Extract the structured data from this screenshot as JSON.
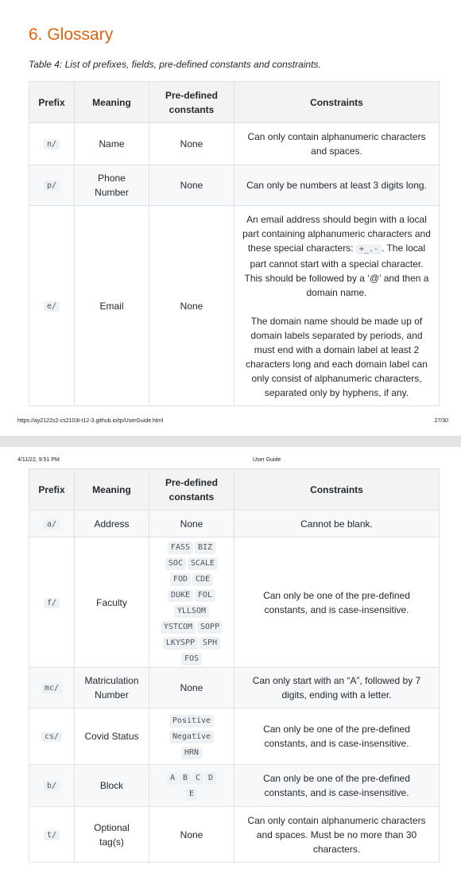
{
  "page1": {
    "heading": "6. Glossary",
    "caption": "Table 4: List of prefixes, fields, pre-defined constants and constraints.",
    "footer": {
      "url": "https://ay2122s2-cs2103t-t12-3.github.io/tp/UserGuide.html",
      "page": "27/30"
    }
  },
  "page2": {
    "header": {
      "date": "4/11/22, 9:51 PM",
      "title": "User Guide"
    }
  },
  "table": {
    "headers": [
      "Prefix",
      "Meaning",
      "Pre-defined constants",
      "Constraints"
    ],
    "rows": [
      {
        "prefix": "n/",
        "meaning": "Name",
        "constants_text": "None",
        "constraints": "Can only contain alphanumeric characters and spaces."
      },
      {
        "prefix": "p/",
        "meaning": "Phone Number",
        "constants_text": "None",
        "constraints": "Can only be numbers at least 3 digits long."
      },
      {
        "prefix": "e/",
        "meaning": "Email",
        "constants_text": "None",
        "constraints_parts": [
          "An email address should begin with a local part containing alphanumeric characters and these special characters:",
          "+_.-",
          ". The local part cannot start with a special character. This should be followed by a ‘@’ and then a domain name."
        ],
        "constraints_2": "The domain name should be made up of domain labels separated by periods, and must end with a domain label at least 2 characters long and each domain label can only consist of alphanumeric characters, separated only by hyphens, if any."
      },
      {
        "prefix": "a/",
        "meaning": "Address",
        "constants_text": "None",
        "constraints": "Cannot be blank."
      },
      {
        "prefix": "f/",
        "meaning": "Faculty",
        "constants": [
          "FASS",
          "BIZ",
          "SOC",
          "SCALE",
          "FOD",
          "CDE",
          "DUKE",
          "FOL",
          "YLLSOM",
          "YSTCOM",
          "SOPP",
          "LKYSPP",
          "SPH",
          "FOS"
        ],
        "constraints": "Can only be one of the pre-defined constants, and is case-insensitive."
      },
      {
        "prefix": "mc/",
        "meaning": "Matriculation Number",
        "constants_text": "None",
        "constraints": "Can only start with an “A”, followed by 7 digits, ending with a letter."
      },
      {
        "prefix": "cs/",
        "meaning": "Covid Status",
        "constants": [
          "Positive",
          "Negative",
          "HRN"
        ],
        "constraints": "Can only be one of the pre-defined constants, and is case-insensitive."
      },
      {
        "prefix": "b/",
        "meaning": "Block",
        "constants": [
          "A",
          "B",
          "C",
          "D",
          "E"
        ],
        "constraints": "Can only be one of the pre-defined constants, and is case-insensitive."
      },
      {
        "prefix": "t/",
        "meaning": "Optional tag(s)",
        "constants_text": "None",
        "constraints": "Can only contain alphanumeric characters and spaces. Must be no more than 30 characters."
      }
    ]
  }
}
